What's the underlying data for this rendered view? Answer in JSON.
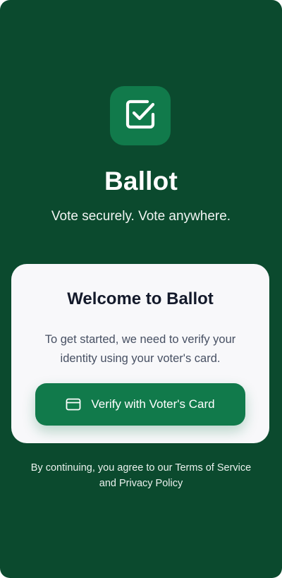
{
  "app": {
    "icon": "checkbox-icon",
    "title": "Ballot",
    "tagline": "Vote securely. Vote anywhere."
  },
  "card": {
    "title": "Welcome to Ballot",
    "description": "To get started, we need to verify your identity using your voter's card.",
    "button": {
      "label": "Verify with Voter's Card",
      "icon": "card-icon"
    }
  },
  "footer": {
    "text": "By continuing, you agree to our Terms of Service and Privacy Policy"
  },
  "colors": {
    "background": "#0b4a2e",
    "accent": "#117a4b",
    "card": "#f8f8fa"
  }
}
